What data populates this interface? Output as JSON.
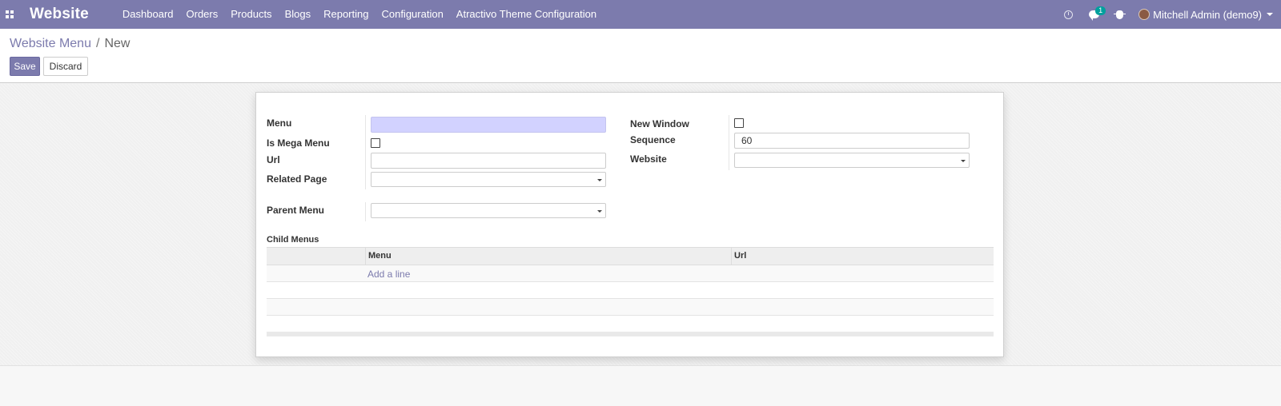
{
  "navbar": {
    "brand": "Website",
    "menu": [
      "Dashboard",
      "Orders",
      "Products",
      "Blogs",
      "Reporting",
      "Configuration",
      "Atractivo Theme Configuration"
    ],
    "chat_badge": "1",
    "user_name": "Mitchell Admin (demo9)",
    "icons": [
      "apps-icon",
      "clock-icon",
      "chat-icon",
      "bug-icon",
      "avatar",
      "caret-down-icon"
    ]
  },
  "breadcrumb": {
    "parent": "Website Menu",
    "separator": "/",
    "current": "New"
  },
  "buttons": {
    "save": "Save",
    "discard": "Discard"
  },
  "form": {
    "menu_label": "Menu",
    "menu_value": "",
    "is_mega_menu_label": "Is Mega Menu",
    "is_mega_menu": false,
    "url_label": "Url",
    "url_value": "",
    "related_page_label": "Related Page",
    "related_page_value": "",
    "parent_menu_label": "Parent Menu",
    "parent_menu_value": "",
    "new_window_label": "New Window",
    "new_window": false,
    "sequence_label": "Sequence",
    "sequence_value": "60",
    "website_label": "Website",
    "website_value": ""
  },
  "child_menus": {
    "title": "Child Menus",
    "columns": [
      "Menu",
      "Url"
    ],
    "add_line": "Add a line"
  },
  "colors": {
    "primary": "#7c7bad",
    "required_field": "#d2d2ff",
    "badge": "#00a09d"
  }
}
